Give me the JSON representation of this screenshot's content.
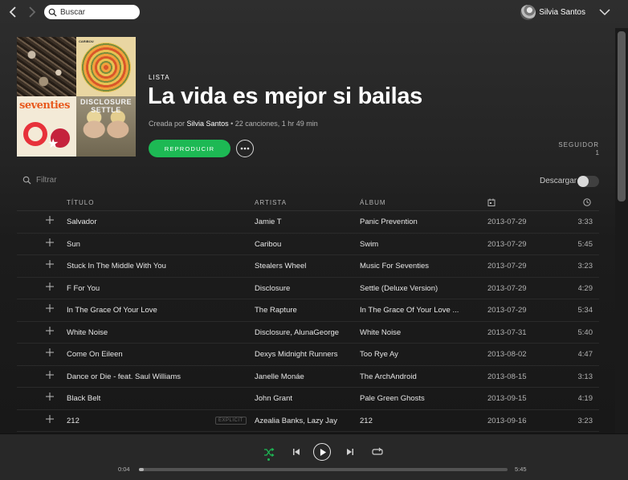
{
  "topbar": {
    "search_placeholder": "Buscar",
    "user_name": "Silvia Santos"
  },
  "playlist": {
    "kind_label": "LISTA",
    "title": "La vida es mejor si bailas",
    "created_by_label": "Creada por",
    "owner": "Silvia Santos",
    "summary": " • 22 canciones, 1 hr 49 min",
    "play_label": "REPRODUCIR",
    "followers_label": "SEGUIDOR",
    "followers_count": "1",
    "cover_texts": {
      "tile2": "CARIBOU",
      "tile3": "seventies",
      "tile4": "DISCLOSURE SETTLE"
    }
  },
  "filter": {
    "placeholder": "Filtrar",
    "download_label": "Descargar",
    "download_enabled": false
  },
  "table": {
    "headers": {
      "title": "TÍTULO",
      "artist": "ARTISTA",
      "album": "ÁLBUM"
    },
    "rows": [
      {
        "title": "Salvador",
        "explicit": "",
        "artist": "Jamie T",
        "album": "Panic Prevention",
        "date": "2013-07-29",
        "duration": "3:33"
      },
      {
        "title": "Sun",
        "explicit": "",
        "artist": "Caribou",
        "album": "Swim",
        "date": "2013-07-29",
        "duration": "5:45"
      },
      {
        "title": "Stuck In The Middle With You",
        "explicit": "",
        "artist": "Stealers Wheel",
        "album": "Music For Seventies",
        "date": "2013-07-29",
        "duration": "3:23"
      },
      {
        "title": "F For You",
        "explicit": "",
        "artist": "Disclosure",
        "album": "Settle (Deluxe Version)",
        "date": "2013-07-29",
        "duration": "4:29"
      },
      {
        "title": "In The Grace Of Your Love",
        "explicit": "",
        "artist": "The Rapture",
        "album": "In The Grace Of Your Love ...",
        "date": "2013-07-29",
        "duration": "5:34"
      },
      {
        "title": "White Noise",
        "explicit": "",
        "artist": "Disclosure, AlunaGeorge",
        "album": "White Noise",
        "date": "2013-07-31",
        "duration": "5:40"
      },
      {
        "title": "Come On Eileen",
        "explicit": "",
        "artist": "Dexys Midnight Runners",
        "album": "Too Rye Ay",
        "date": "2013-08-02",
        "duration": "4:47"
      },
      {
        "title": "Dance or Die - feat. Saul Williams",
        "explicit": "",
        "artist": "Janelle Monáe",
        "album": "The ArchAndroid",
        "date": "2013-08-15",
        "duration": "3:13"
      },
      {
        "title": "Black Belt",
        "explicit": "",
        "artist": "John Grant",
        "album": "Pale Green Ghosts",
        "date": "2013-09-15",
        "duration": "4:19"
      },
      {
        "title": "212",
        "explicit": "EXPLICIT",
        "artist": "Azealia Banks, Lazy Jay",
        "album": "212",
        "date": "2013-09-16",
        "duration": "3:23"
      }
    ]
  },
  "player": {
    "elapsed": "0:04",
    "total": "5:45",
    "progress_fraction": 0.012,
    "shuffle_active": true
  },
  "colors": {
    "accent": "#1db954",
    "background": "#181818",
    "player_bg": "#282828",
    "muted_text": "#b3b3b3"
  },
  "icons": [
    "back-arrow-icon",
    "forward-arrow-icon",
    "search-icon",
    "chevron-down-icon",
    "more-icon",
    "calendar-icon",
    "clock-icon",
    "plus-icon",
    "shuffle-icon",
    "previous-icon",
    "play-icon",
    "next-icon",
    "repeat-icon"
  ]
}
